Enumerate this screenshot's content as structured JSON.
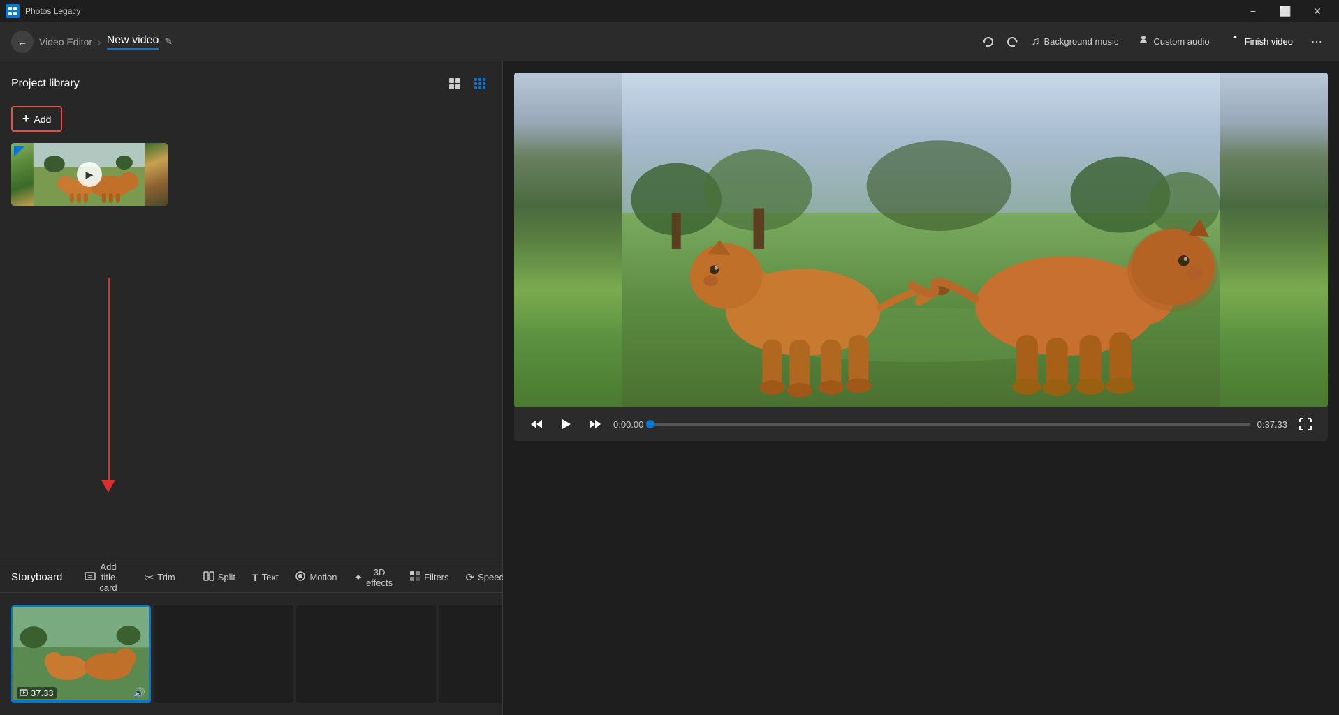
{
  "titlebar": {
    "app_name": "Photos Legacy",
    "minimize_label": "−",
    "maximize_label": "⬜",
    "close_label": "✕"
  },
  "appbar": {
    "back_icon": "←",
    "breadcrumb_parent": "Video Editor",
    "breadcrumb_separator": "›",
    "current_title": "New video",
    "edit_icon": "✎",
    "undo_icon": "↺",
    "redo_icon": "↻",
    "bg_music_label": "Background music",
    "bg_music_icon": "♫",
    "custom_audio_label": "Custom audio",
    "custom_audio_icon": "🎤",
    "finish_video_label": "Finish video",
    "finish_video_icon": "⬆",
    "more_icon": "⋯"
  },
  "project_library": {
    "title": "Project library",
    "add_label": "Add",
    "add_icon": "+",
    "grid_icon_large": "⊞",
    "grid_icon_small": "⊟",
    "collapse_icon": "❮",
    "media_items": [
      {
        "id": "1",
        "has_flag": true,
        "has_play": true,
        "type": "video"
      }
    ]
  },
  "storyboard": {
    "title": "Storyboard",
    "actions": [
      {
        "id": "add-title-card",
        "label": "Add title card",
        "icon": "⊞"
      },
      {
        "id": "trim",
        "label": "Trim",
        "icon": "✂"
      },
      {
        "id": "split",
        "label": "Split",
        "icon": "⧉"
      },
      {
        "id": "text",
        "label": "Text",
        "icon": "T"
      },
      {
        "id": "motion",
        "label": "Motion",
        "icon": "◎"
      },
      {
        "id": "3d-effects",
        "label": "3D effects",
        "icon": "✦"
      },
      {
        "id": "filters",
        "label": "Filters",
        "icon": "⬡"
      },
      {
        "id": "speed",
        "label": "Speed",
        "icon": "⟳"
      }
    ],
    "more_icon": "⋯",
    "crop_icon": "⊡",
    "audio_icon": "🔊",
    "delete_icon": "🗑",
    "clip": {
      "duration": "37.33",
      "has_audio": true,
      "progress_pct": 100
    }
  },
  "video_player": {
    "current_time": "0:00.00",
    "total_time": "0:37.33",
    "rewind_icon": "⏮",
    "play_icon": "▶",
    "forward_icon": "⏭",
    "fullscreen_icon": "⤢",
    "progress_pct": 0
  }
}
